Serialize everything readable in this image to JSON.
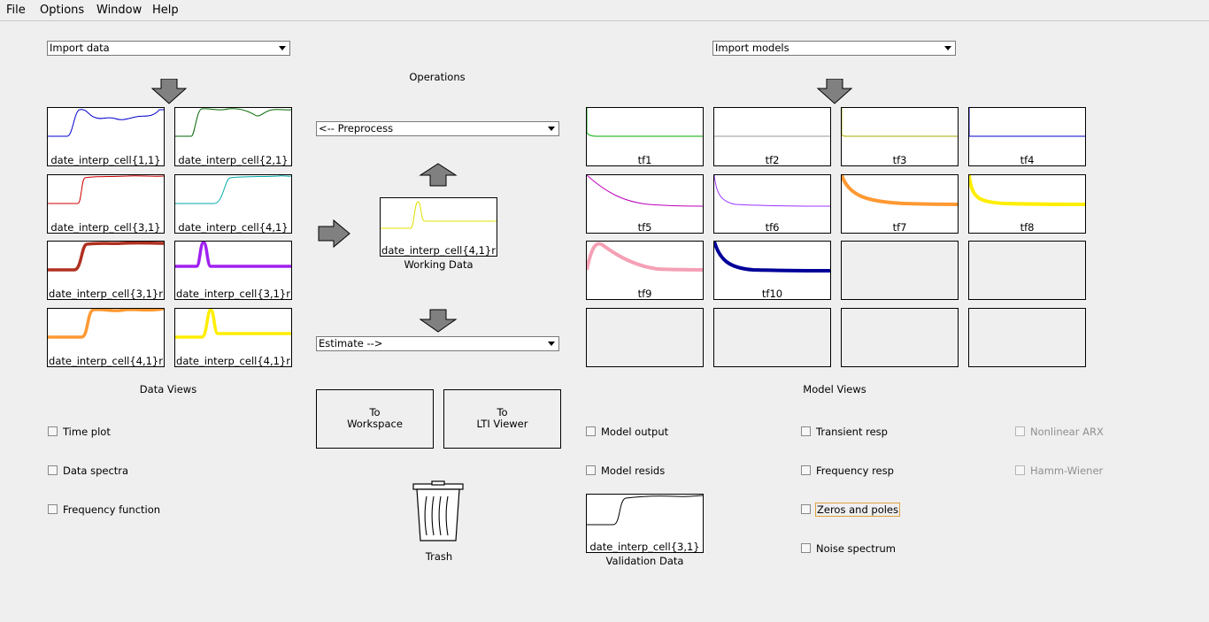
{
  "menu": {
    "file": "File",
    "options": "Options",
    "window": "Window",
    "help": "Help"
  },
  "import_data": {
    "selected": "Import data"
  },
  "import_models": {
    "selected": "Import models"
  },
  "operations": {
    "title": "Operations",
    "preprocess": "<-- Preprocess",
    "estimate": "Estimate -->",
    "to_workspace_line1": "To",
    "to_workspace_line2": "Workspace",
    "to_lti_line1": "To",
    "to_lti_line2": "LTI Viewer",
    "trash": "Trash"
  },
  "working_data": {
    "name": "date_interp_cell{4,1}r",
    "caption": "Working Data",
    "color": "#e0e000"
  },
  "validation_data": {
    "name": "date_interp_cell{3,1}",
    "caption": "Validation Data",
    "color": "#000000"
  },
  "data_tiles": [
    {
      "name": "date_interp_cell{1,1}",
      "color": "#0000cc"
    },
    {
      "name": "date_interp_cell{2,1}",
      "color": "#006600"
    },
    {
      "name": "date_interp_cell{3,1}",
      "color": "#cc0000"
    },
    {
      "name": "date_interp_cell{4,1}",
      "color": "#00aaaa"
    },
    {
      "name": "date_interp_cell{3,1}r",
      "color": "#b03020"
    },
    {
      "name": "date_interp_cell{3,1}r",
      "color": "#a020f0"
    },
    {
      "name": "date_interp_cell{4,1}r",
      "color": "#ff9933"
    },
    {
      "name": "date_interp_cell{4,1}r",
      "color": "#ffee00"
    }
  ],
  "data_views": {
    "title": "Data Views",
    "time_plot": "Time plot",
    "data_spectra": "Data spectra",
    "frequency_function": "Frequency function"
  },
  "model_tiles": [
    {
      "name": "tf1",
      "color": "#00aa00"
    },
    {
      "name": "tf2",
      "color": "#cccccc"
    },
    {
      "name": "tf3",
      "color": "#aaaa00"
    },
    {
      "name": "tf4",
      "color": "#0000cc"
    },
    {
      "name": "tf5",
      "color": "#bb00bb"
    },
    {
      "name": "tf6",
      "color": "#9933ff"
    },
    {
      "name": "tf7",
      "color": "#ff9933"
    },
    {
      "name": "tf8",
      "color": "#ffee00"
    },
    {
      "name": "tf9",
      "color": "#f5a0b5"
    },
    {
      "name": "tf10",
      "color": "#000099"
    }
  ],
  "model_views": {
    "title": "Model Views",
    "model_output": "Model output",
    "model_resids": "Model resids",
    "transient_resp": "Transient resp",
    "frequency_resp": "Frequency resp",
    "zeros_and_poles": "Zeros and poles",
    "noise_spectrum": "Noise spectrum",
    "nonlinear_arx": "Nonlinear ARX",
    "hamm_wiener": "Hamm-Wiener"
  }
}
